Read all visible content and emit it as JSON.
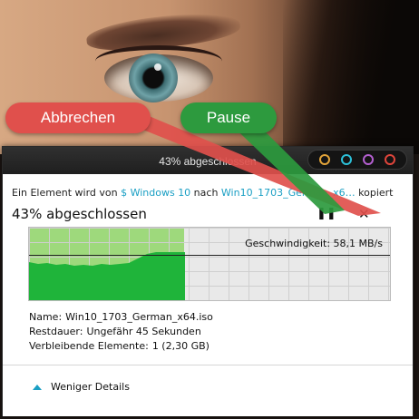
{
  "annotations": {
    "cancel_label": "Abbrechen",
    "pause_label": "Pause",
    "cancel_color": "#e0504c",
    "pause_color": "#2d9a3e"
  },
  "window": {
    "title": "43% abgeschlossen",
    "title_button_colors": [
      "#e2a43a",
      "#2cc0d8",
      "#b35fd0",
      "#e0453b"
    ]
  },
  "copy": {
    "prefix": "Ein Element wird von ",
    "source": "$ Windows 10",
    "middle": " nach ",
    "destination": "Win10_1703_German_x6…",
    "suffix": " kopiert",
    "status": "43% abgeschlossen",
    "pause_icon": "pause-icon",
    "close_icon": "close-icon",
    "progress": 0.43,
    "speed_label": "Geschwindigkeit: 58,1 MB/s"
  },
  "details": {
    "name_label": "Name:",
    "name_value": "Win10_1703_German_x64.iso",
    "remaining_label": "Restdauer:",
    "remaining_value": "Ungefähr 45 Sekunden",
    "items_label": "Verbleibende Elemente:",
    "items_value": "1 (2,30 GB)"
  },
  "footer": {
    "toggle_label": "Weniger Details"
  }
}
